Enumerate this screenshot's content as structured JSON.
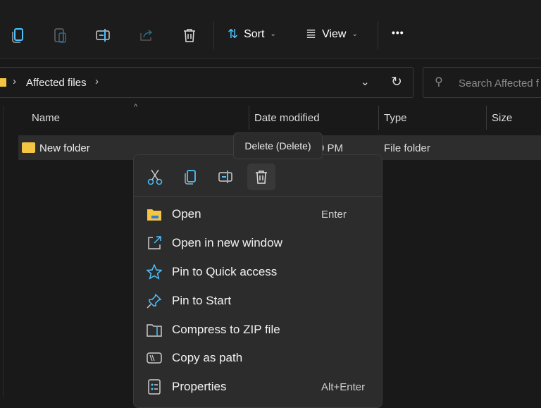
{
  "toolbar": {
    "sort_label": "Sort",
    "view_label": "View",
    "more_label": "•••"
  },
  "address": {
    "path": "Affected files"
  },
  "search": {
    "placeholder": "Search Affected f"
  },
  "columns": {
    "name": "Name",
    "date": "Date modified",
    "type": "Type",
    "size": "Size"
  },
  "row": {
    "name": "New folder",
    "date": "9 PM",
    "type": "File folder"
  },
  "tooltip": "Delete (Delete)",
  "menu": {
    "items": [
      {
        "label": "Open",
        "shortcut": "Enter",
        "icon": "folder-icon"
      },
      {
        "label": "Open in new window",
        "shortcut": "",
        "icon": "open-new-window-icon"
      },
      {
        "label": "Pin to Quick access",
        "shortcut": "",
        "icon": "star-icon"
      },
      {
        "label": "Pin to Start",
        "shortcut": "",
        "icon": "pin-icon"
      },
      {
        "label": "Compress to ZIP file",
        "shortcut": "",
        "icon": "zip-folder-icon"
      },
      {
        "label": "Copy as path",
        "shortcut": "",
        "icon": "copy-path-icon"
      },
      {
        "label": "Properties",
        "shortcut": "Alt+Enter",
        "icon": "properties-icon"
      }
    ]
  },
  "colors": {
    "accent": "#4cc2ff",
    "folder": "#f4c542",
    "background": "#191919",
    "menu": "#2c2c2c"
  }
}
